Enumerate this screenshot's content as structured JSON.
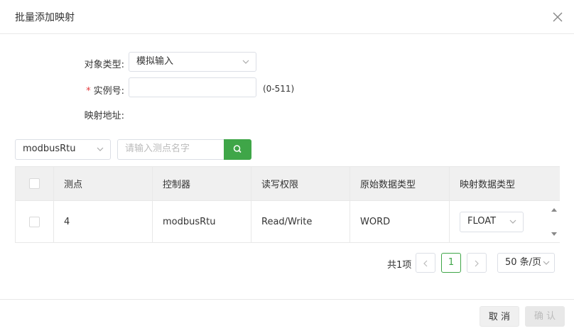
{
  "dialog": {
    "title": "批量添加映射",
    "close_icon": "close-icon"
  },
  "form": {
    "object_type_label": "对象类型:",
    "object_type_value": "模拟输入",
    "instance_label": "实例号:",
    "instance_required_mark": "*",
    "instance_value": "",
    "instance_range": "(0-511)",
    "map_address_label": "映射地址:"
  },
  "filter": {
    "protocol_value": "modbusRtu",
    "search_placeholder": "请输入测点名字"
  },
  "table": {
    "headers": [
      "测点",
      "控制器",
      "读写权限",
      "原始数据类型",
      "映射数据类型"
    ],
    "rows": [
      {
        "point": "4",
        "controller": "modbusRtu",
        "permission": "Read/Write",
        "raw_type": "WORD",
        "map_type": "FLOAT"
      }
    ]
  },
  "pagination": {
    "total": "共1项",
    "current_page": "1",
    "page_size": "50 条/页"
  },
  "footer": {
    "cancel_label": "取 消",
    "confirm_label": "确 认"
  },
  "colors": {
    "accent": "#3fa648",
    "required": "#e4393c"
  }
}
